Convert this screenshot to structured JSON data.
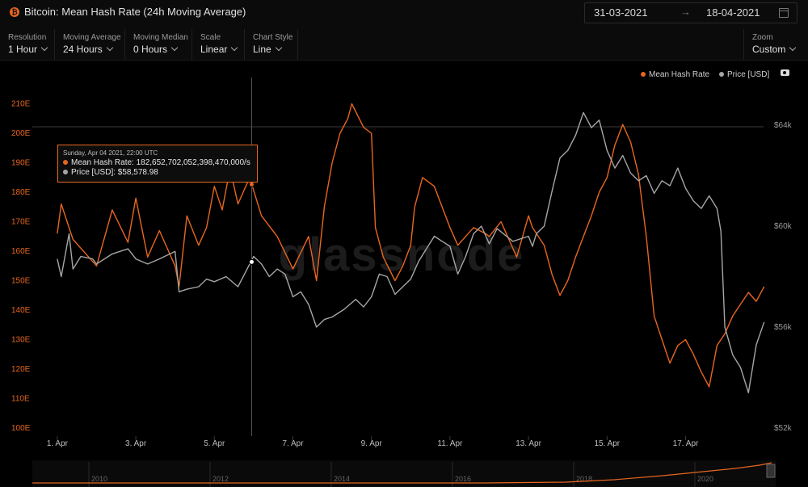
{
  "header": {
    "title": "Bitcoin: Mean Hash Rate (24h Moving Average)",
    "date_from": "31-03-2021",
    "date_arrow": "→",
    "date_to": "18-04-2021"
  },
  "controls": [
    {
      "label": "Resolution",
      "value": "1 Hour"
    },
    {
      "label": "Moving Average",
      "value": "24 Hours"
    },
    {
      "label": "Moving Median",
      "value": "0 Hours"
    },
    {
      "label": "Scale",
      "value": "Linear"
    },
    {
      "label": "Chart Style",
      "value": "Line"
    }
  ],
  "zoom": {
    "label": "Zoom",
    "value": "Custom"
  },
  "legend": {
    "hash": "Mean Hash Rate",
    "price": "Price [USD]"
  },
  "colors": {
    "hash": "#e8661f",
    "price": "#a6a6a6",
    "bg": "#000000"
  },
  "watermark": "glassnode",
  "tooltip": {
    "date": "Sunday, Apr 04 2021, 22:00 UTC",
    "hash": "Mean Hash Rate: 182,652,702,052,398,470,000/s",
    "price": "Price [USD]: $58,578.98"
  },
  "chart_data": {
    "type": "line",
    "x_labels": [
      "1. Apr",
      "3. Apr",
      "5. Apr",
      "7. Apr",
      "9. Apr",
      "11. Apr",
      "13. Apr",
      "15. Apr",
      "17. Apr"
    ],
    "x_range_days": [
      31.0,
      49.0
    ],
    "y_left": {
      "ticks": [
        "100E",
        "110E",
        "120E",
        "130E",
        "140E",
        "150E",
        "160E",
        "170E",
        "180E",
        "190E",
        "200E",
        "210E"
      ],
      "range": [
        100,
        213
      ]
    },
    "y_right": {
      "ticks": [
        "$52k",
        "$56k",
        "$60k",
        "$64k"
      ],
      "range": [
        52000,
        64150
      ]
    },
    "grid": "none",
    "legend_position": "top-right",
    "series": [
      {
        "name": "Mean Hash Rate",
        "axis": "left",
        "unit": "E",
        "points": [
          [
            31.0,
            166
          ],
          [
            31.1,
            176
          ],
          [
            31.4,
            164
          ],
          [
            31.8,
            158
          ],
          [
            32.0,
            155
          ],
          [
            32.4,
            174
          ],
          [
            32.8,
            163
          ],
          [
            33.0,
            178
          ],
          [
            33.3,
            158
          ],
          [
            33.6,
            167
          ],
          [
            34.0,
            155
          ],
          [
            34.1,
            148
          ],
          [
            34.3,
            172
          ],
          [
            34.6,
            162
          ],
          [
            34.8,
            168
          ],
          [
            35.0,
            182
          ],
          [
            35.2,
            174
          ],
          [
            35.4,
            188
          ],
          [
            35.6,
            176
          ],
          [
            35.9,
            185
          ],
          [
            36.2,
            172
          ],
          [
            36.6,
            165
          ],
          [
            37.0,
            154
          ],
          [
            37.4,
            165
          ],
          [
            37.6,
            150
          ],
          [
            37.8,
            175
          ],
          [
            38.0,
            190
          ],
          [
            38.2,
            200
          ],
          [
            38.4,
            205
          ],
          [
            38.5,
            210
          ],
          [
            38.8,
            202
          ],
          [
            39.0,
            200
          ],
          [
            39.1,
            168
          ],
          [
            39.3,
            158
          ],
          [
            39.6,
            150
          ],
          [
            39.8,
            155
          ],
          [
            40.0,
            162
          ],
          [
            40.1,
            175
          ],
          [
            40.3,
            185
          ],
          [
            40.6,
            182
          ],
          [
            40.8,
            175
          ],
          [
            41.0,
            168
          ],
          [
            41.2,
            162
          ],
          [
            41.6,
            168
          ],
          [
            41.9,
            166
          ],
          [
            42.0,
            165
          ],
          [
            42.3,
            170
          ],
          [
            42.7,
            158
          ],
          [
            43.0,
            172
          ],
          [
            43.1,
            168
          ],
          [
            43.4,
            162
          ],
          [
            43.6,
            152
          ],
          [
            43.8,
            145
          ],
          [
            44.0,
            150
          ],
          [
            44.2,
            158
          ],
          [
            44.4,
            165
          ],
          [
            44.6,
            172
          ],
          [
            44.8,
            180
          ],
          [
            45.0,
            185
          ],
          [
            45.2,
            196
          ],
          [
            45.4,
            203
          ],
          [
            45.6,
            197
          ],
          [
            45.8,
            186
          ],
          [
            46.0,
            165
          ],
          [
            46.2,
            138
          ],
          [
            46.4,
            130
          ],
          [
            46.6,
            122
          ],
          [
            46.8,
            128
          ],
          [
            47.0,
            130
          ],
          [
            47.2,
            125
          ],
          [
            47.4,
            119
          ],
          [
            47.6,
            114
          ],
          [
            47.8,
            128
          ],
          [
            48.0,
            132
          ],
          [
            48.2,
            138
          ],
          [
            48.4,
            142
          ],
          [
            48.6,
            146
          ],
          [
            48.8,
            143
          ],
          [
            49.0,
            148
          ]
        ]
      },
      {
        "name": "Price [USD]",
        "axis": "right",
        "unit": "USD",
        "points": [
          [
            31.0,
            58700
          ],
          [
            31.1,
            58000
          ],
          [
            31.3,
            59700
          ],
          [
            31.4,
            58300
          ],
          [
            31.6,
            58800
          ],
          [
            31.9,
            58700
          ],
          [
            32.0,
            58500
          ],
          [
            32.4,
            58900
          ],
          [
            32.8,
            59100
          ],
          [
            33.0,
            58700
          ],
          [
            33.3,
            58500
          ],
          [
            33.6,
            58700
          ],
          [
            34.0,
            59000
          ],
          [
            34.1,
            57400
          ],
          [
            34.3,
            57500
          ],
          [
            34.6,
            57600
          ],
          [
            34.8,
            57900
          ],
          [
            35.0,
            57800
          ],
          [
            35.3,
            58000
          ],
          [
            35.6,
            57600
          ],
          [
            35.8,
            58200
          ],
          [
            36.0,
            58800
          ],
          [
            36.2,
            58500
          ],
          [
            36.4,
            58000
          ],
          [
            36.6,
            58300
          ],
          [
            36.8,
            58100
          ],
          [
            37.0,
            57200
          ],
          [
            37.2,
            57400
          ],
          [
            37.4,
            56900
          ],
          [
            37.6,
            56000
          ],
          [
            37.8,
            56300
          ],
          [
            38.0,
            56400
          ],
          [
            38.3,
            56700
          ],
          [
            38.6,
            57100
          ],
          [
            38.8,
            56800
          ],
          [
            39.0,
            57200
          ],
          [
            39.2,
            58100
          ],
          [
            39.4,
            58000
          ],
          [
            39.6,
            57300
          ],
          [
            39.8,
            57600
          ],
          [
            40.0,
            57900
          ],
          [
            40.2,
            58600
          ],
          [
            40.4,
            59100
          ],
          [
            40.6,
            59600
          ],
          [
            40.8,
            59400
          ],
          [
            41.0,
            59200
          ],
          [
            41.2,
            58100
          ],
          [
            41.4,
            58800
          ],
          [
            41.6,
            59700
          ],
          [
            41.8,
            60000
          ],
          [
            42.0,
            59300
          ],
          [
            42.2,
            59900
          ],
          [
            42.6,
            59400
          ],
          [
            43.0,
            59600
          ],
          [
            43.1,
            59200
          ],
          [
            43.2,
            59700
          ],
          [
            43.4,
            60000
          ],
          [
            43.6,
            61400
          ],
          [
            43.8,
            62700
          ],
          [
            44.0,
            63000
          ],
          [
            44.2,
            63600
          ],
          [
            44.4,
            64500
          ],
          [
            44.6,
            63900
          ],
          [
            44.8,
            64200
          ],
          [
            45.0,
            63000
          ],
          [
            45.2,
            62300
          ],
          [
            45.4,
            62800
          ],
          [
            45.6,
            62100
          ],
          [
            45.8,
            61800
          ],
          [
            46.0,
            62000
          ],
          [
            46.2,
            61300
          ],
          [
            46.4,
            61800
          ],
          [
            46.6,
            61600
          ],
          [
            46.8,
            62300
          ],
          [
            47.0,
            61500
          ],
          [
            47.2,
            61000
          ],
          [
            47.4,
            60700
          ],
          [
            47.6,
            61200
          ],
          [
            47.8,
            60700
          ],
          [
            47.9,
            59800
          ],
          [
            48.0,
            56000
          ],
          [
            48.2,
            54900
          ],
          [
            48.4,
            54400
          ],
          [
            48.6,
            53400
          ],
          [
            48.8,
            55300
          ],
          [
            49.0,
            56200
          ]
        ]
      }
    ],
    "crosshair_day": 35.95,
    "navigator": {
      "labels": [
        "2010",
        "2012",
        "2014",
        "2016",
        "2018",
        "2020"
      ]
    }
  }
}
